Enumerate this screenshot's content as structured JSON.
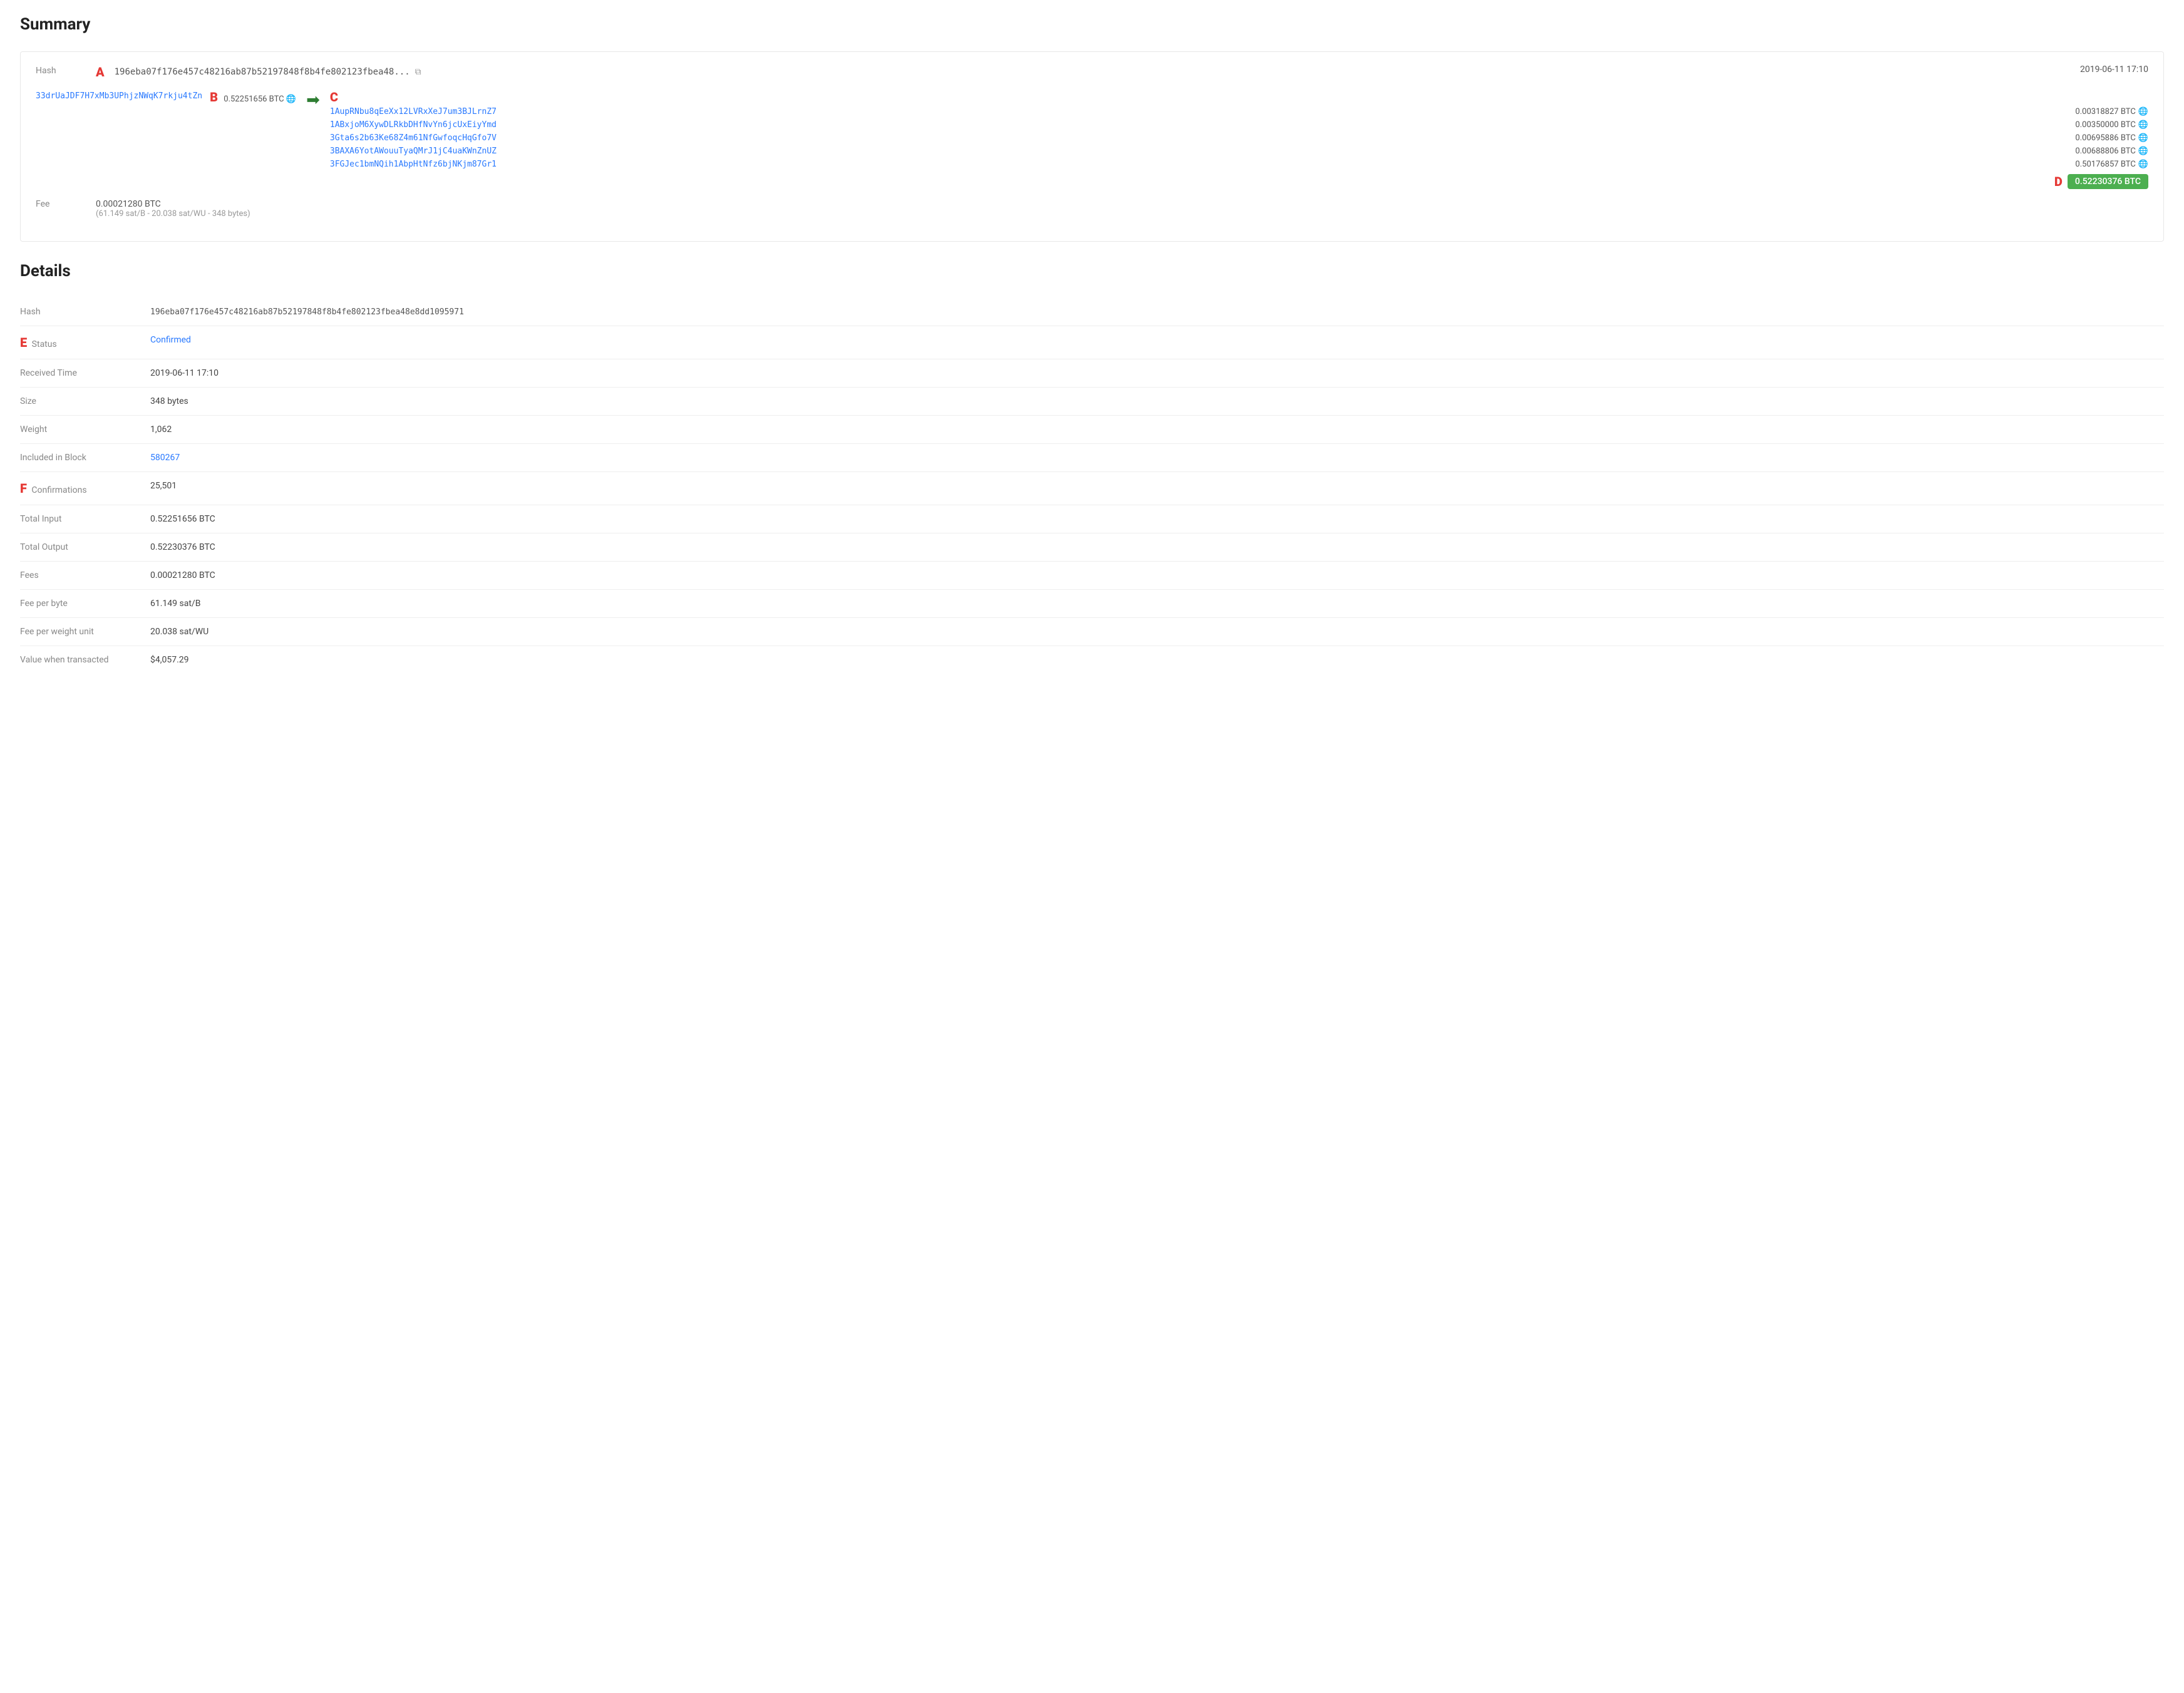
{
  "summary": {
    "title": "Summary",
    "hash_short": "196eba07f176e457c48216ab87b52197848f8b4fe802123fbea48...",
    "hash_full": "196eba07f176e457c48216ab87b52197848f8b4fe802123fbea48e8dd1095971",
    "timestamp": "2019-06-11 17:10",
    "input_address": "33drUaJDF7H7xMb3UPhjzNWqK7rkju4tZn",
    "input_amount": "0.52251656 BTC",
    "outputs": [
      {
        "address": "1AupRNbu8qEeXx12LVRxXeJ7um3BJLrnZ7",
        "amount": "0.00318827 BTC"
      },
      {
        "address": "1ABxjoM6XywDLRkbDHfNvYn6jcUxEiyYmd",
        "amount": "0.00350000 BTC"
      },
      {
        "address": "3Gta6s2b63Ke68Z4m61NfGwfoqcHqGfo7V",
        "amount": "0.00695886 BTC"
      },
      {
        "address": "3BAXA6YotAWouuTyaQMrJ1jC4uaKWnZnUZ",
        "amount": "0.00688806 BTC"
      },
      {
        "address": "3FGJec1bmNQih1AbpHtNfz6bjNKjm87Gr1",
        "amount": "0.50176857 BTC"
      }
    ],
    "total_output_badge": "0.52230376 BTC",
    "fee_btc": "0.00021280 BTC",
    "fee_detail": "(61.149 sat/B - 20.038 sat/WU - 348 bytes)"
  },
  "details": {
    "title": "Details",
    "rows": [
      {
        "label": "Hash",
        "value": "196eba07f176e457c48216ab87b52197848f8b4fe802123fbea48e8dd1095971",
        "type": "hash"
      },
      {
        "label": "Status",
        "value": "Confirmed",
        "type": "status"
      },
      {
        "label": "Received Time",
        "value": "2019-06-11 17:10",
        "type": "text"
      },
      {
        "label": "Size",
        "value": "348 bytes",
        "type": "text"
      },
      {
        "label": "Weight",
        "value": "1,062",
        "type": "text"
      },
      {
        "label": "Included in Block",
        "value": "580267",
        "type": "link"
      },
      {
        "label": "Confirmations",
        "value": "25,501",
        "type": "text"
      },
      {
        "label": "Total Input",
        "value": "0.52251656 BTC",
        "type": "text"
      },
      {
        "label": "Total Output",
        "value": "0.52230376 BTC",
        "type": "text"
      },
      {
        "label": "Fees",
        "value": "0.00021280 BTC",
        "type": "text"
      },
      {
        "label": "Fee per byte",
        "value": "61.149 sat/B",
        "type": "text"
      },
      {
        "label": "Fee per weight unit",
        "value": "20.038 sat/WU",
        "type": "text"
      },
      {
        "label": "Value when transacted",
        "value": "$4,057.29",
        "type": "text"
      }
    ]
  },
  "annotations": {
    "A": "A",
    "B": "B",
    "C": "C",
    "D": "D",
    "E": "E",
    "F": "F"
  },
  "icons": {
    "copy": "⧉",
    "globe": "🌐",
    "arrow_right": "➡"
  }
}
